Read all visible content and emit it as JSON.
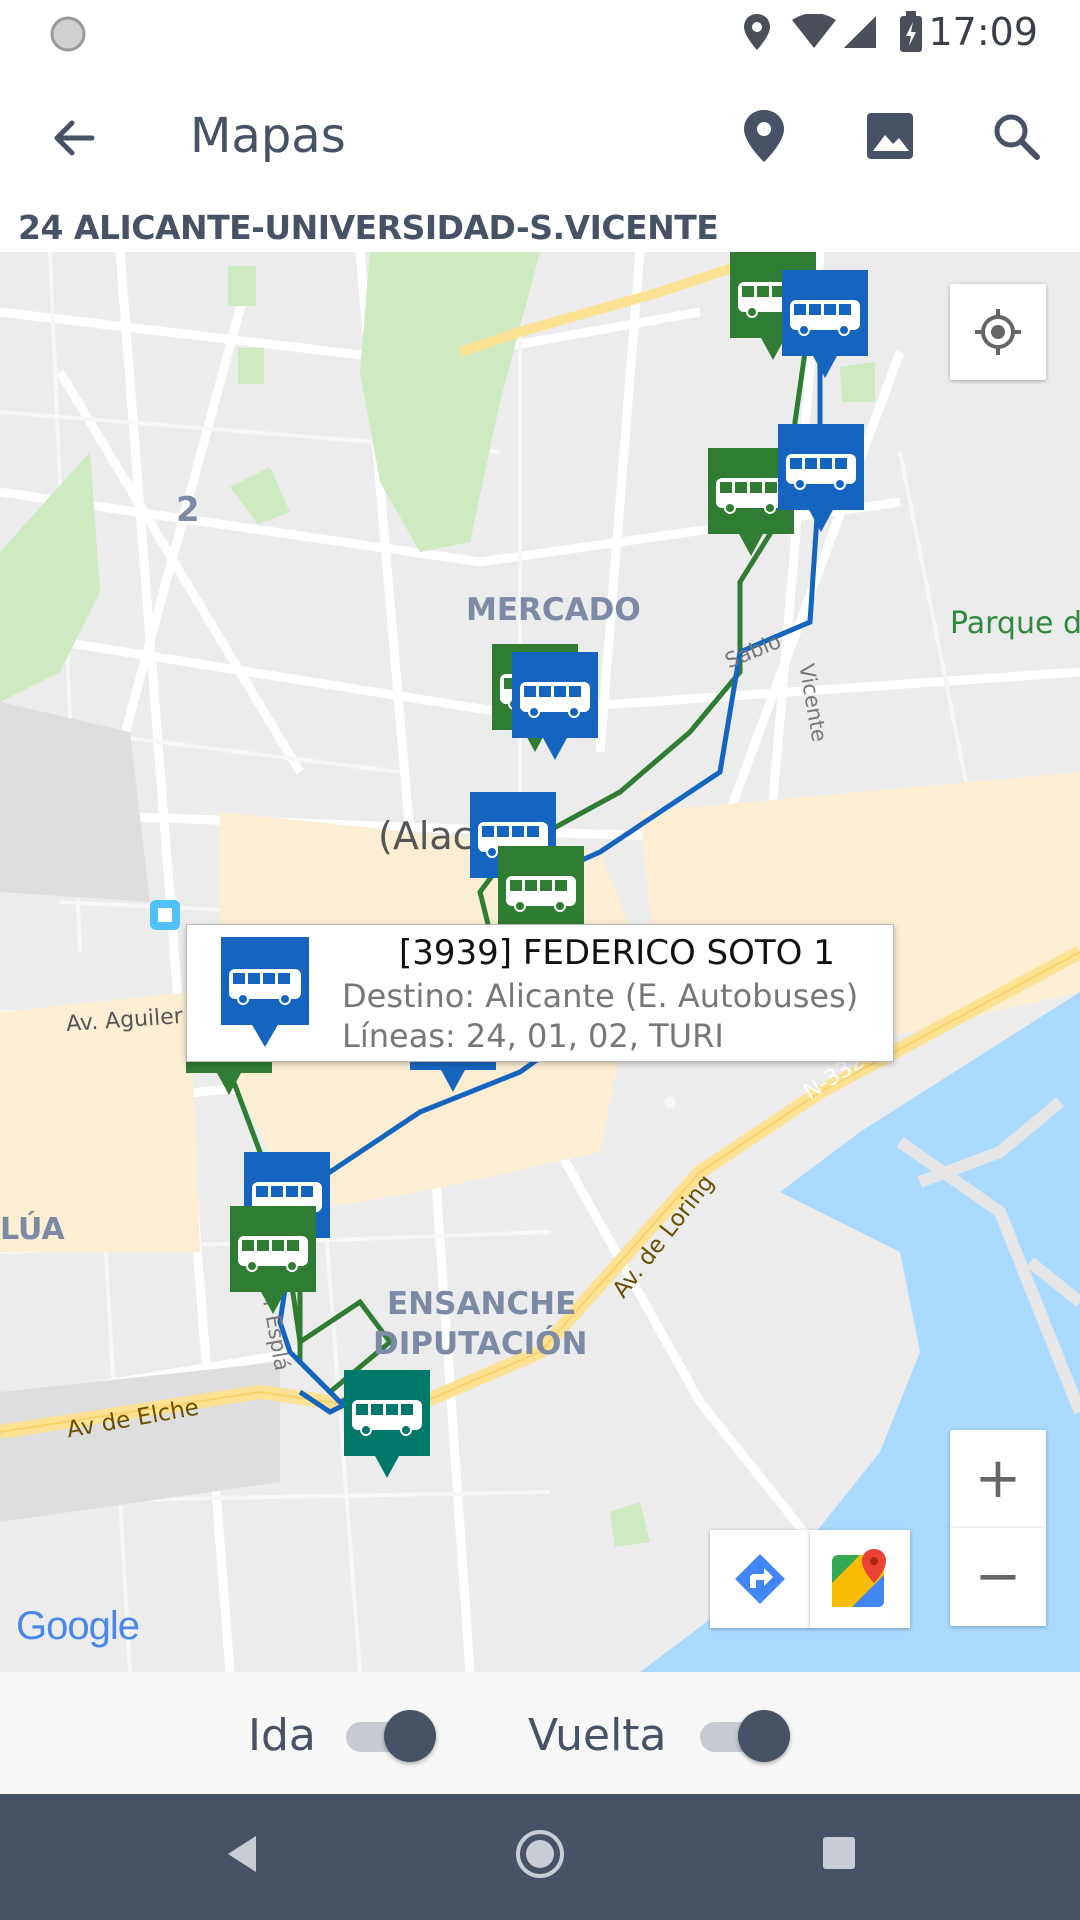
{
  "status_bar": {
    "time": "17:09"
  },
  "app_bar": {
    "title": "Mapas",
    "back_icon": "arrow-back-icon",
    "actions": [
      "location-pin-icon",
      "image-icon",
      "search-icon"
    ]
  },
  "route": {
    "name": "24 ALICANTE-UNIVERSIDAD-S.VICENTE"
  },
  "map": {
    "labels": {
      "mercado": "MERCADO",
      "parque": "Parque d",
      "alacant": "(Alaca",
      "aguilera": "Av. Aguiler",
      "lua": "LÚA",
      "ensanche_1": "ENSANCHE",
      "ensanche_2": "DIPUTACIÓN",
      "elche": "Av de Elche",
      "loring": "Av. de Loring",
      "n332": "N-332",
      "esplai": "r Esplá",
      "vicente": "Vicente",
      "sabio": "Sabio",
      "num2": "2",
      "google": "Google"
    },
    "info_window": {
      "title": "[3939] FEDERICO SOTO 1",
      "destino": "Destino: Alicante (E. Autobuses)",
      "lineas": "Líneas: 24, 01, 02, TURI"
    },
    "controls": {
      "my_location_icon": "my-location-icon",
      "zoom_in": "+",
      "zoom_out": "−",
      "directions_icon": "directions-icon",
      "google_maps_icon": "google-maps-icon"
    },
    "colors": {
      "ida": "#2e7d32",
      "vuelta": "#1565c0",
      "terminal": "#00796b"
    }
  },
  "toggles": {
    "ida_label": "Ida",
    "vuelta_label": "Vuelta",
    "ida_on": true,
    "vuelta_on": true
  },
  "nav_bar": {
    "icons": [
      "back-triangle-icon",
      "home-circle-icon",
      "recents-square-icon"
    ]
  }
}
